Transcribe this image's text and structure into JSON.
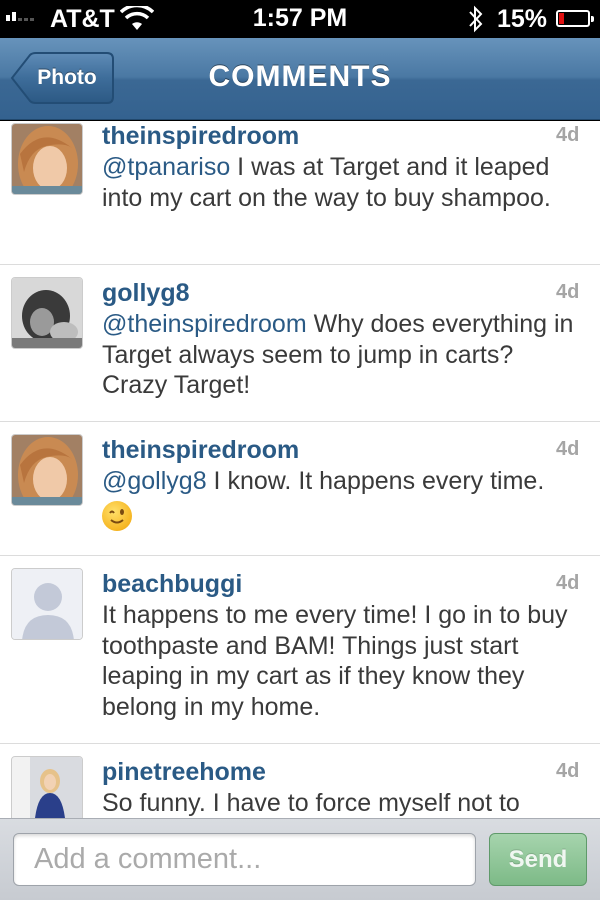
{
  "status_bar": {
    "carrier": "AT&T",
    "time": "1:57 PM",
    "battery_percent": "15%",
    "battery_level": 0.15,
    "icons": [
      "signal-icon",
      "wifi-icon",
      "bluetooth-icon",
      "battery-icon"
    ]
  },
  "nav": {
    "back_label": "Photo",
    "title": "COMMENTS"
  },
  "comments": [
    {
      "user": "theinspiredroom",
      "age": "4d",
      "mention": "@tpanariso",
      "text": " I was at Target and it leaped into my cart on the way to buy shampoo.",
      "avatar": "avatar-woman-blonde"
    },
    {
      "user": "gollyg8",
      "age": "4d",
      "mention": "@theinspiredroom",
      "text": " Why does everything in Target always seem to jump in carts? Crazy Target!",
      "avatar": "avatar-bw-photo"
    },
    {
      "user": "theinspiredroom",
      "age": "4d",
      "mention": "@gollyg8",
      "text": " I know. It happens every time.",
      "emoji": "wink-emoji",
      "avatar": "avatar-woman-blonde"
    },
    {
      "user": "beachbuggi",
      "age": "4d",
      "mention": "",
      "text": "It happens to me every time! I go in to buy toothpaste and BAM! Things just start leaping in my cart as if they know they belong in my home.",
      "avatar": "avatar-default-silhouette"
    },
    {
      "user": "pinetreehome",
      "age": "4d",
      "mention": "",
      "text": "So funny. I have to force myself not to",
      "avatar": "avatar-woman-mirror"
    }
  ],
  "comment_bar": {
    "placeholder": "Add a comment...",
    "send_label": "Send"
  },
  "colors": {
    "nav_blue": "#4a78a3",
    "username_blue": "#2a5a85",
    "send_green": "#7dba87",
    "battery_red": "#e01010"
  }
}
